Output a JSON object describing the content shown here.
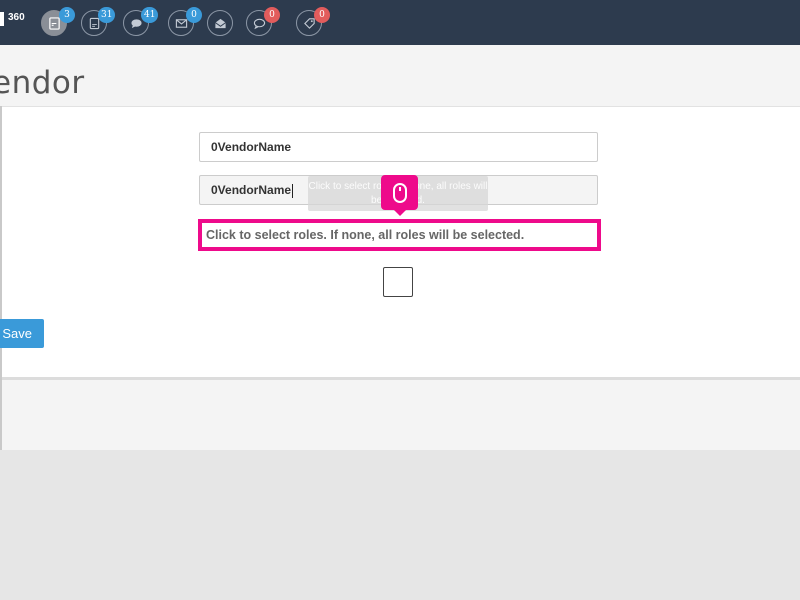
{
  "brand": {
    "text": "360"
  },
  "nav": {
    "icons": [
      {
        "name": "reports-icon",
        "badge": "3",
        "badge_color": "#3a9ad9"
      },
      {
        "name": "document-icon",
        "badge": "31",
        "badge_color": "#3a9ad9"
      },
      {
        "name": "chat-icon",
        "badge": "41",
        "badge_color": "#3a9ad9"
      },
      {
        "name": "mail-icon",
        "badge": "0",
        "badge_color": "#3a9ad9"
      },
      {
        "name": "open-mail-icon",
        "badge": "",
        "badge_color": ""
      },
      {
        "name": "comment-icon",
        "badge": "0",
        "badge_color": "#e25c5c"
      },
      {
        "name": "tag-icon",
        "badge": "0",
        "badge_color": "#e25c5c"
      }
    ]
  },
  "page": {
    "title": "endor"
  },
  "form": {
    "vendor_name_1": "0VendorName",
    "vendor_name_2": "0VendorName",
    "tooltip_text": "Click to select roles. If none, all roles will be selected.",
    "roles_hint": "Click to select roles. If none, all roles will be selected.",
    "save_label": "Save"
  },
  "colors": {
    "topbar": "#2d3b4e",
    "accent": "#3a9ad9",
    "highlight": "#ee0a8b",
    "badge_red": "#e25c5c"
  }
}
